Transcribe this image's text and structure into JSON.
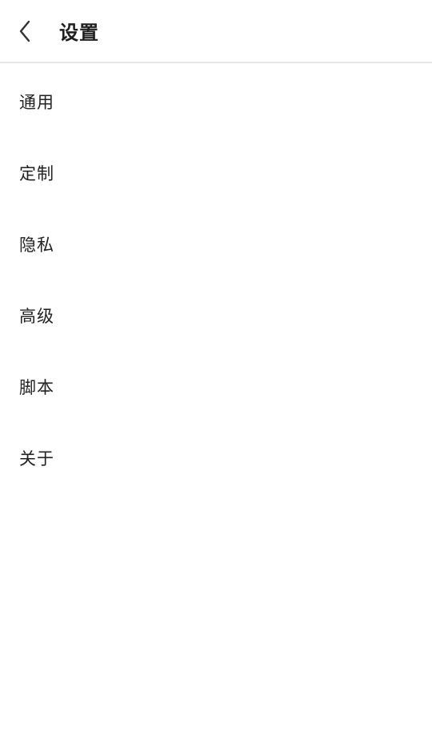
{
  "header": {
    "title": "设置",
    "back_icon": "chevron-left-icon"
  },
  "menu": {
    "items": [
      {
        "label": "通用"
      },
      {
        "label": "定制"
      },
      {
        "label": "隐私"
      },
      {
        "label": "高级"
      },
      {
        "label": "脚本"
      },
      {
        "label": "关于"
      }
    ]
  },
  "colors": {
    "background": "#ffffff",
    "text": "#222222",
    "divider": "#e6e6e6"
  }
}
